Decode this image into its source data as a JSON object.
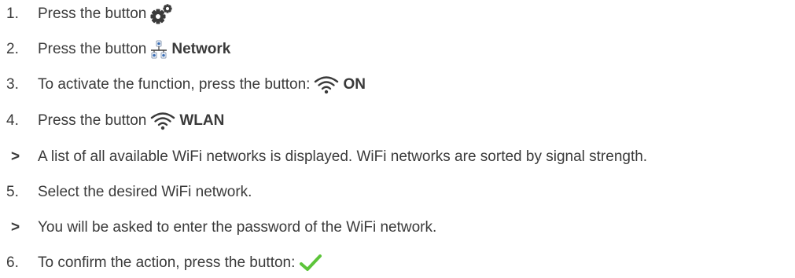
{
  "steps": [
    {
      "marker": "1.",
      "text": "Press the button",
      "icon": "settings-gears-icon"
    },
    {
      "marker": "2.",
      "text": "Press the button",
      "icon": "network-icon",
      "label": "Network"
    },
    {
      "marker": "3.",
      "text": "To activate the function, press the button:",
      "icon": "wifi-icon",
      "label": "ON"
    },
    {
      "marker": "4.",
      "text": "Press the button",
      "icon": "wifi-icon",
      "label": "WLAN"
    },
    {
      "marker": ">",
      "text": "A list of all available WiFi networks is displayed. WiFi networks are sorted by signal strength."
    },
    {
      "marker": "5.",
      "text": "Select the desired WiFi network."
    },
    {
      "marker": ">",
      "text": "You will be asked to enter the password of the WiFi network."
    },
    {
      "marker": "6.",
      "text": "To confirm the action, press the button:",
      "icon": "checkmark-icon"
    }
  ],
  "colors": {
    "text": "#3a3a3a",
    "icon": "#3a3a3a",
    "network_node": "#3b6fb6",
    "checkmark": "#5cc43a"
  }
}
